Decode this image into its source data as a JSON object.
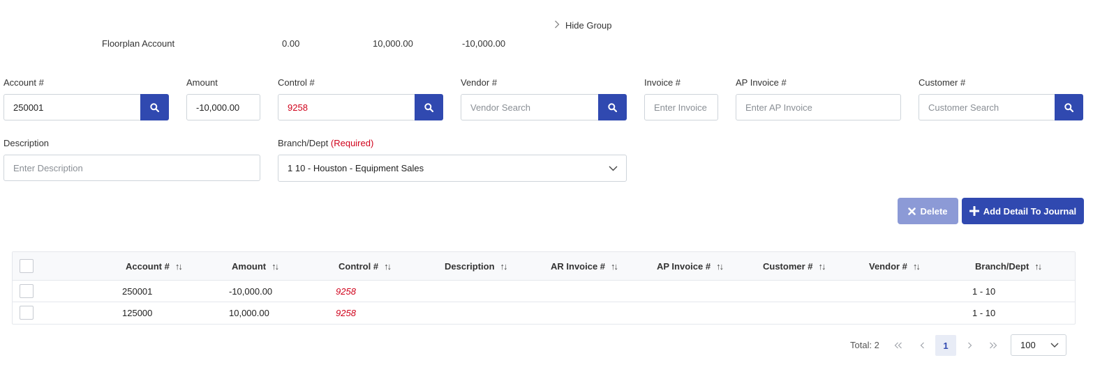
{
  "summary": {
    "hide_group": "Hide Group",
    "account_name": "Floorplan Account",
    "col1": "0.00",
    "col2": "10,000.00",
    "col3": "-10,000.00"
  },
  "form": {
    "account": {
      "label": "Account #",
      "value": "250001"
    },
    "amount": {
      "label": "Amount",
      "value": "-10,000.00"
    },
    "control": {
      "label": "Control #",
      "value": "9258"
    },
    "vendor": {
      "label": "Vendor #",
      "placeholder": "Vendor Search"
    },
    "invoice": {
      "label": "Invoice #",
      "placeholder": "Enter Invoice"
    },
    "ap_invoice": {
      "label": "AP Invoice #",
      "placeholder": "Enter AP Invoice"
    },
    "customer": {
      "label": "Customer #",
      "placeholder": "Customer Search"
    },
    "description": {
      "label": "Description",
      "placeholder": "Enter Description"
    },
    "branch": {
      "label": "Branch/Dept",
      "required": "(Required)",
      "value": "1 10 - Houston - Equipment Sales"
    }
  },
  "buttons": {
    "delete": "Delete",
    "add": "Add Detail To Journal"
  },
  "table": {
    "columns": [
      "Account #",
      "Amount",
      "Control #",
      "Description",
      "AR Invoice #",
      "AP Invoice #",
      "Customer #",
      "Vendor #",
      "Branch/Dept"
    ],
    "rows": [
      {
        "account": "250001",
        "amount": "-10,000.00",
        "control": "9258",
        "branch": "1 - 10"
      },
      {
        "account": "125000",
        "amount": "10,000.00",
        "control": "9258",
        "branch": "1 - 10"
      }
    ]
  },
  "pagination": {
    "total": "Total: 2",
    "current_page": "1",
    "page_size": "100"
  },
  "colors": {
    "primary": "#3049b0",
    "primary_disabled": "#8c9ad6",
    "required": "#d0021b"
  },
  "icons": {
    "search": "search-icon",
    "chevron_right": "chevron-right-icon",
    "chevron_down": "chevron-down-icon",
    "close": "close-icon",
    "plus": "plus-icon",
    "sort": "sort-icon"
  }
}
